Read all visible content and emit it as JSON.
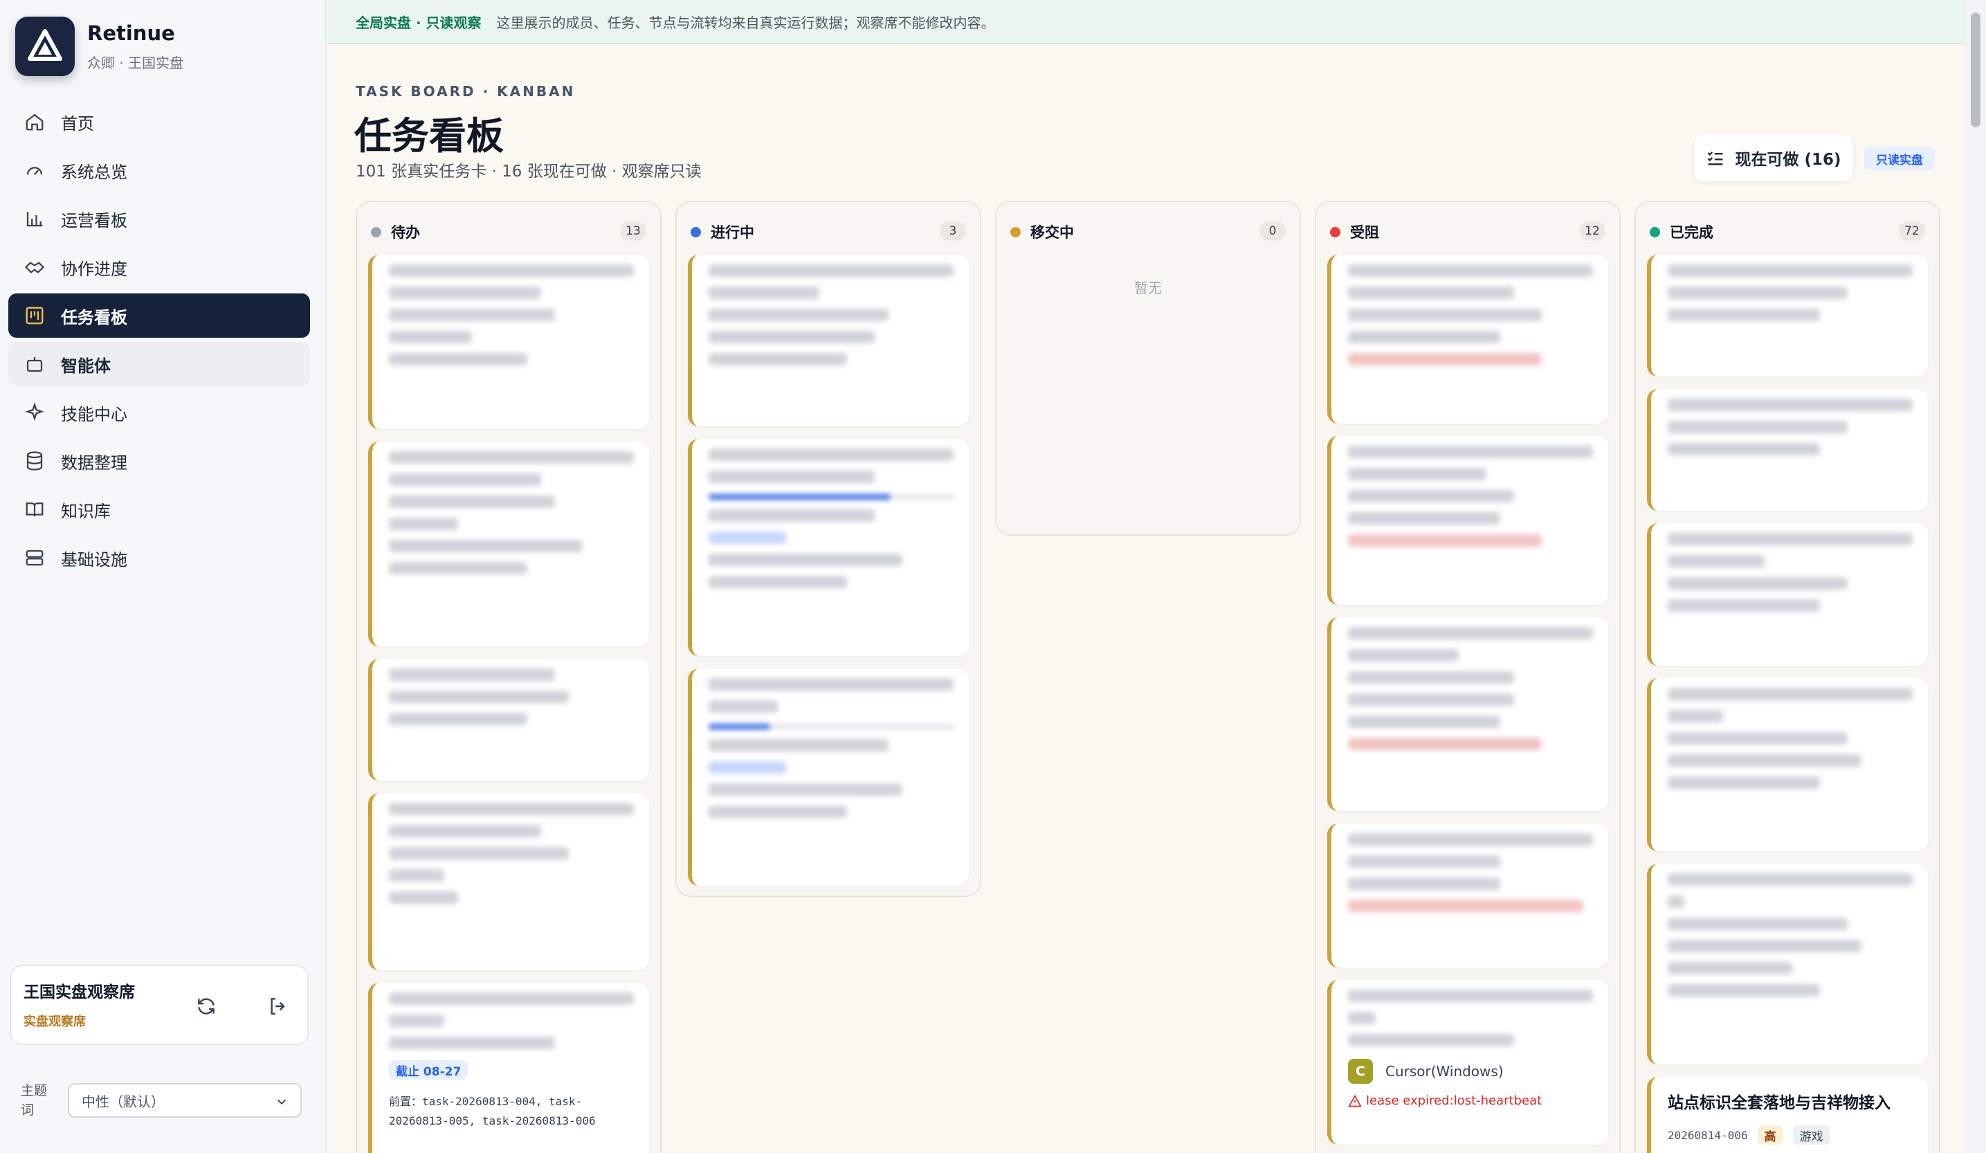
{
  "brand": {
    "name": "Retinue",
    "sub": "众卿 · 王国实盘"
  },
  "nav": [
    {
      "label": "首页",
      "icon": "home-icon"
    },
    {
      "label": "系统总览",
      "icon": "gauge-icon"
    },
    {
      "label": "运营看板",
      "icon": "bar-chart-icon"
    },
    {
      "label": "协作进度",
      "icon": "handshake-icon"
    },
    {
      "label": "任务看板",
      "icon": "kanban-icon",
      "active": true
    },
    {
      "label": "智能体",
      "icon": "bot-icon"
    },
    {
      "label": "技能中心",
      "icon": "sparkles-icon"
    },
    {
      "label": "数据整理",
      "icon": "database-icon"
    },
    {
      "label": "知识库",
      "icon": "book-icon"
    },
    {
      "label": "基础设施",
      "icon": "server-icon"
    }
  ],
  "observer": {
    "title": "王国实盘观察席",
    "sub": "实盘观察席"
  },
  "theme": {
    "label": "主题词",
    "value": "中性（默认）"
  },
  "banner": {
    "tag": "全局实盘 · 只读观察",
    "text": "这里展示的成员、任务、节点与流转均来自真实运行数据；观察席不能修改内容。"
  },
  "header": {
    "eyebrow": "TASK BOARD · KANBAN",
    "title": "任务看板",
    "subtitle": "101 张真实任务卡 · 16 张现在可做 · 观察席只读",
    "can_do_button": "现在可做 (16)",
    "readonly_badge": "只读实盘"
  },
  "columns": [
    {
      "title": "待办",
      "count": "13",
      "color": "#9ca3af"
    },
    {
      "title": "进行中",
      "count": "3",
      "color": "#3b6fe0"
    },
    {
      "title": "移交中",
      "count": "0",
      "color": "#d69e2e",
      "empty": "暂无"
    },
    {
      "title": "受阻",
      "count": "12",
      "color": "#e53e3e"
    },
    {
      "title": "已完成",
      "count": "72",
      "color": "#14a37f"
    }
  ],
  "cards": {
    "todo_5": {
      "due": "截止 08-27",
      "deps": "前置：task-20260813-004, task-20260813-005, task-20260813-006"
    },
    "blocked_5": {
      "assignee_initial": "C",
      "assignee": "Cursor(Windows)",
      "warning": "lease expired:lost-heartbeat"
    },
    "done_6": {
      "title": "站点标识全套落地与吉祥物接入",
      "id": "20260814-006",
      "priority": "高",
      "tag": "游戏"
    }
  },
  "colors": {
    "accent": "#16213a",
    "gold": "#c8a43a",
    "danger": "#dc2626",
    "success": "#0f7a55"
  }
}
